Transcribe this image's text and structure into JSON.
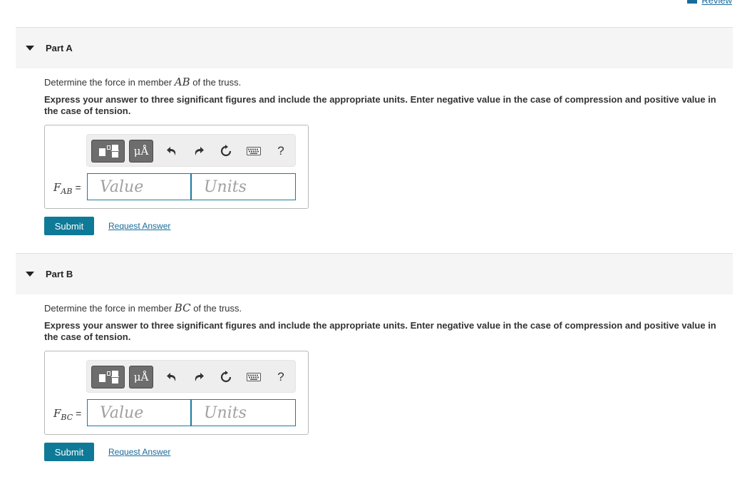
{
  "review": {
    "label": "Review"
  },
  "parts": [
    {
      "title": "Part A",
      "question_prefix": "Determine the force in member ",
      "member": "AB",
      "question_suffix": " of the truss.",
      "instruction": "Express your answer to three significant figures and include the appropriate units. Enter negative value in the case of compression and positive value in the case of tension.",
      "var_main": "F",
      "var_sub": "AB",
      "equals": "=",
      "value_placeholder": "Value",
      "units_placeholder": "Units",
      "help": "?",
      "mu": "μÅ",
      "submit": "Submit",
      "request": "Request Answer"
    },
    {
      "title": "Part B",
      "question_prefix": "Determine the force in member ",
      "member": "BC",
      "question_suffix": " of the truss.",
      "instruction": "Express your answer to three significant figures and include the appropriate units. Enter negative value in the case of compression and positive value in the case of tension.",
      "var_main": "F",
      "var_sub": "BC",
      "equals": "=",
      "value_placeholder": "Value",
      "units_placeholder": "Units",
      "help": "?",
      "mu": "μÅ",
      "submit": "Submit",
      "request": "Request Answer"
    }
  ],
  "icons": [
    "templates-icon",
    "units-icon",
    "undo-icon",
    "redo-icon",
    "reset-icon",
    "keyboard-icon",
    "help-icon",
    "caret-down-icon",
    "book-icon"
  ]
}
